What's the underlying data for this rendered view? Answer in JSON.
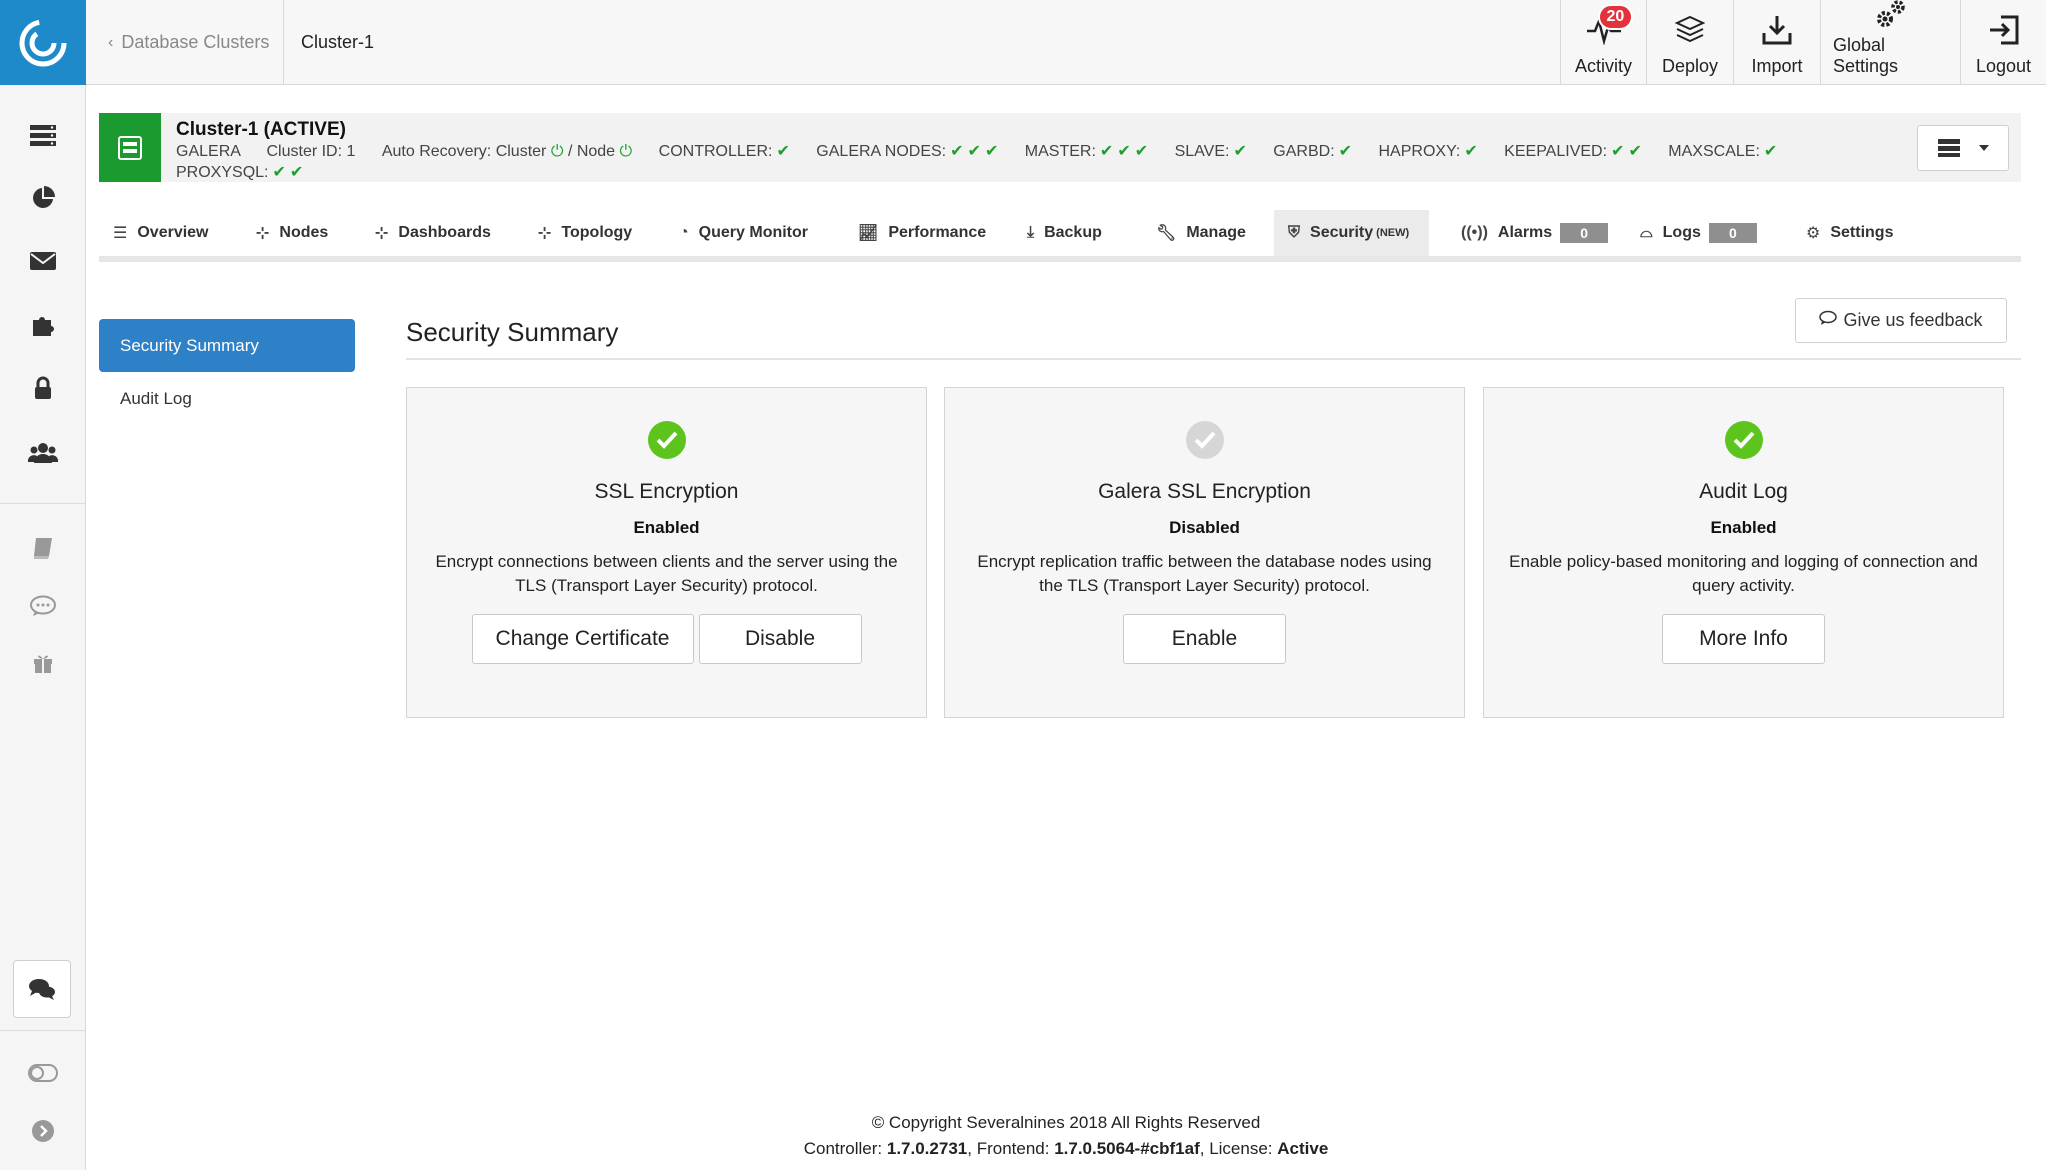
{
  "breadcrumb": {
    "back_label": "Database Clusters",
    "current": "Cluster-1"
  },
  "top_actions": [
    {
      "label": "Activity",
      "badge": "20",
      "icon": "activity-pulse-icon"
    },
    {
      "label": "Deploy",
      "icon": "layers-icon"
    },
    {
      "label": "Import",
      "icon": "import-icon"
    },
    {
      "label": "Global Settings",
      "icon": "gears-icon"
    },
    {
      "label": "Logout",
      "icon": "logout-icon"
    }
  ],
  "cluster": {
    "title": "Cluster-1 (ACTIVE)",
    "type": "GALERA",
    "cluster_id": "Cluster ID: 1",
    "auto_recovery": "Auto Recovery: Cluster",
    "auto_recovery_node": "/ Node",
    "controller": "CONTROLLER:",
    "galera_nodes": "GALERA NODES:",
    "master": "MASTER:",
    "slave": "SLAVE:",
    "garbd": "GARBD:",
    "haproxy": "HAPROXY:",
    "keepalived": "KEEPALIVED:",
    "maxscale": "MAXSCALE:",
    "proxysql": "PROXYSQL:",
    "ok_color": "#1fa02e",
    "status_color": "#1a9a2f"
  },
  "tabs": {
    "overview": "Overview",
    "nodes": "Nodes",
    "dashboards": "Dashboards",
    "topology": "Topology",
    "query_monitor": "Query Monitor",
    "performance": "Performance",
    "backup": "Backup",
    "manage": "Manage",
    "security": "Security",
    "security_tag": "(NEW)",
    "alarms": "Alarms",
    "alarms_count": "0",
    "logs": "Logs",
    "logs_count": "0",
    "settings": "Settings"
  },
  "side_menu": {
    "active": "Security Summary",
    "audit_log": "Audit Log"
  },
  "main": {
    "title": "Security Summary",
    "feedback_label": "Give us feedback"
  },
  "cards": [
    {
      "title": "SSL Encryption",
      "state": "Enabled",
      "enabled": true,
      "desc": "Encrypt connections between clients and the server using the TLS (Transport Layer Security) protocol.",
      "btn1": "Change Certificate",
      "btn2": "Disable"
    },
    {
      "title": "Galera SSL Encryption",
      "state": "Disabled",
      "enabled": false,
      "desc": "Encrypt replication traffic between the database nodes using the TLS (Transport Layer Security) protocol.",
      "btn1": "Enable"
    },
    {
      "title": "Audit Log",
      "state": "Enabled",
      "enabled": true,
      "desc": "Enable policy-based monitoring and logging of connection and query activity.",
      "btn1": "More Info"
    }
  ],
  "footer": {
    "copyright": "© Copyright Severalnines 2018 All Rights Reserved",
    "controller_label": "Controller:",
    "controller_version": "1.7.0.2731",
    "frontend_label": "Frontend:",
    "frontend_version": "1.7.0.5064-#cbf1af",
    "license_label": "License:",
    "license_value": "Active"
  },
  "colors": {
    "brand": "#1f8ac9",
    "active_menu": "#2e80c7",
    "badge": "#e2323b",
    "check_green": "#5cc41c",
    "check_gray": "#d6d6d6"
  }
}
